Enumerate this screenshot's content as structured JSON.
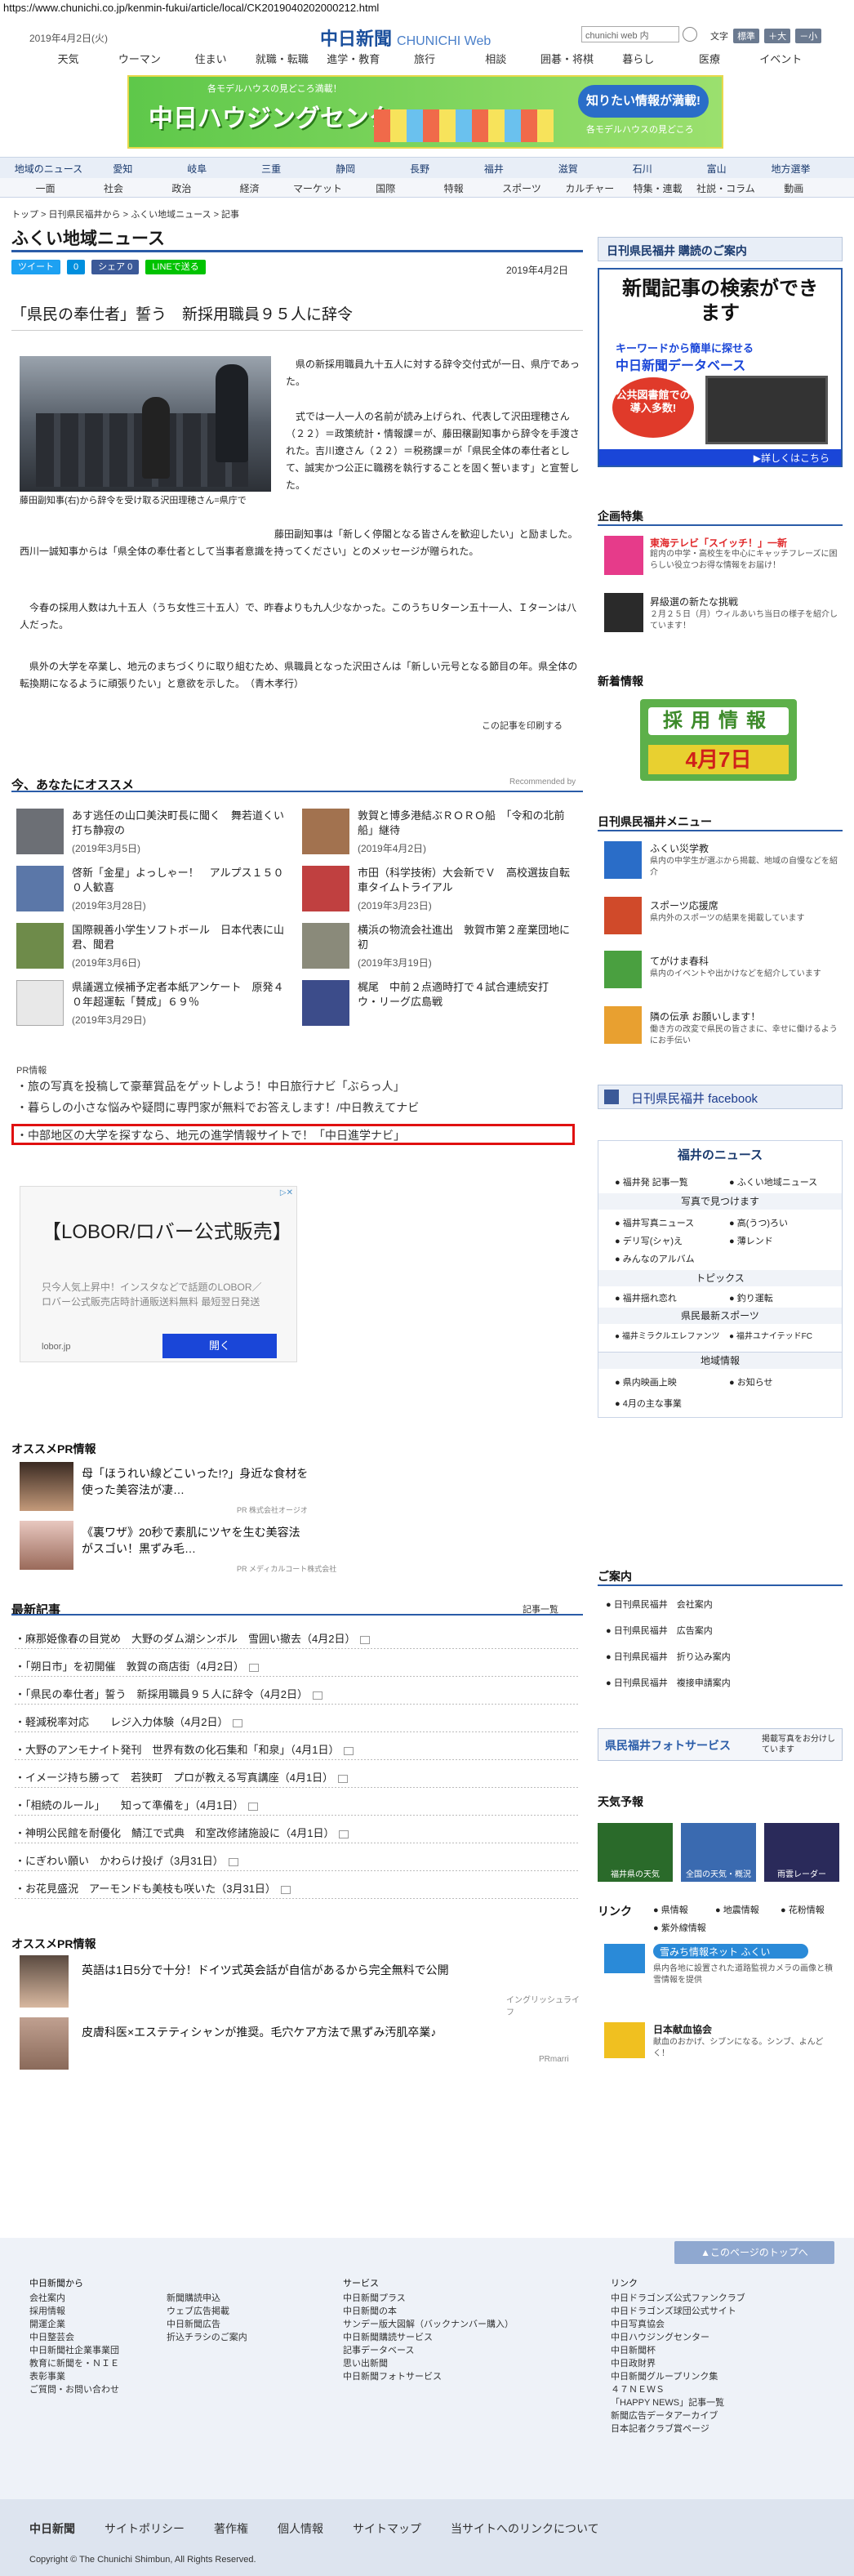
{
  "browser": {
    "url": "https://www.chunichi.co.jp/kenmin-fukui/article/local/CK2019040202000212.html"
  },
  "header": {
    "date": "2019年4月2日(火)",
    "logo": "中日新聞",
    "logo_sub": "CHUNICHI Web",
    "search_placeholder": "chunichi web 内",
    "font_label": "文字",
    "font_standard": "標準",
    "font_large": "＋大",
    "font_small": "－小",
    "nav": [
      "天気",
      "ウーマン",
      "住まい",
      "就職・転職",
      "進学・教育",
      "旅行",
      "相談",
      "囲碁・将棋",
      "暮らし",
      "医療",
      "イベント"
    ]
  },
  "banner": {
    "title": "中日ハウジングセンター",
    "tagline": "知りたい情報が満載!",
    "top_text": "各モデルハウスの見どころ満載！",
    "sub": "各モデルハウスの見どころ"
  },
  "nav2": [
    "地域のニュース",
    "愛知",
    "岐阜",
    "三重",
    "静岡",
    "長野",
    "福井",
    "滋賀",
    "石川",
    "富山",
    "地方選挙"
  ],
  "nav3": [
    "一面",
    "社会",
    "政治",
    "経済",
    "マーケット",
    "国際",
    "特報",
    "スポーツ",
    "カルチャー",
    "特集・連載",
    "社説・コラム",
    "動画"
  ],
  "breadcrumb": "トップ > 日刊県民福井から > ふくい地域ニュース > 記事",
  "page_title": "ふくい地域ニュース",
  "share": {
    "tweet": "ツイート",
    "hatena": "0",
    "fb": "シェア 0",
    "line": "LINEで送る"
  },
  "article": {
    "date": "2019年4月2日",
    "headline": "「県民の奉仕者」誓う　新採用職員９５人に辞令",
    "caption": "藤田副知事(右)から辞令を受け取る沢田理穂さん=県庁で",
    "p1": "県の新採用職員九十五人に対する辞令交付式が一日、県庁であった。",
    "p2": "式では一人一人の名前が読み上げられ、代表して沢田理穂さん（２２）＝政策統計・情報課＝が、藤田穣副知事から辞令を手渡された。吉川遼さん（２２）＝税務課＝が「県民全体の奉仕者として、誠実かつ公正に職務を執行することを固く誓います」と宣誓した。",
    "p3": "藤田副知事は「新しく停閣となる皆さんを歓迎したい」と励ました。西川一誠知事からは「県全体の奉仕者として当事者意識を持ってください」とのメッセージが贈られた。",
    "p4": "今春の採用人数は九十五人（うち女性三十五人）で、昨春よりも九人少なかった。このうちＵターン五十一人、Ｉターンは八人だった。",
    "p5": "県外の大学を卒業し、地元のまちづくりに取り組むため、県職員となった沢田さんは「新しい元号となる節目の年。県全体の転換期になるように頑張りたい」と意欲を示した。　（青木孝行）",
    "print": "この記事を印刷する"
  },
  "recommend": {
    "title": "今、あなたにオススメ",
    "by": "Recommended by",
    "items": [
      {
        "title": "あす逃任の山口美決町長に聞く　舞若道くい打ち静寂の",
        "date": "(2019年3月5日)"
      },
      {
        "title": "敦賀と博多港結ぶＲＯＲＯ船　「令和の北前船」継待",
        "date": "(2019年4月2日)"
      },
      {
        "title": "啓新「金星」よっしゃー！　アルプス１５００人歓喜",
        "date": "(2019年3月28日)"
      },
      {
        "title": "市田（科学技術）大会新でＶ　高校選抜自転車タイムトライアル",
        "date": "(2019年3月23日)"
      },
      {
        "title": "国際親善小学生ソフトボール　日本代表に山君、聞君",
        "date": "(2019年3月6日)"
      },
      {
        "title": "横浜の物流会社進出　敦賀市第２産業団地に初",
        "date": "(2019年3月19日)"
      },
      {
        "title": "県議選立候補予定者本紙アンケート　原発４０年超運転「賛成」６９％",
        "date": "(2019年3月29日)"
      },
      {
        "title": "梶尾　中前２点適時打で４試合連続安打　ウ・リーグ広島戦",
        "date": ""
      }
    ]
  },
  "pr": {
    "label": "PR情報",
    "links": [
      "旅の写真を投稿して豪華賞品をゲットしよう！中日旅行ナビ「ぶらっ人」",
      "暮らしの小さな悩みや疑問に専門家が無料でお答えします！/中日教えてナビ",
      "中部地区の大学を探すなら、地元の進学情報サイトで！「中日進学ナビ」"
    ]
  },
  "ad": {
    "headline": "【LOBOR/ロバー公式販売】",
    "body": "只今人気上昇中！インスタなどで話題のLOBOR／ロバー公式販売店時計通販送料無料 最短翌日発送",
    "site": "lobor.jp",
    "button": "開く"
  },
  "ospr": {
    "title": "オススメPR情報",
    "items": [
      {
        "title": "母「ほうれい線どこいった!?」身近な食材を使った美容法が凄…",
        "sponsor": "PR 株式会社オージオ"
      },
      {
        "title": "《裏ワザ》20秒で素肌にツヤを生む美容法がスゴい！黒ずみ毛…",
        "sponsor": "PR メディカルコート株式会社"
      }
    ]
  },
  "latest": {
    "title": "最新記事",
    "more": "記事一覧",
    "items": [
      "麻那姫像春の目覚め　大野のダム湖シンボル　雪囲い撤去（4月2日）",
      "「朔日市」を初開催　敦賀の商店街（4月2日）",
      "「県民の奉仕者」誓う　新採用職員９５人に辞令（4月2日）",
      "軽減税率対応　　レジ入力体験（4月2日）",
      "大野のアンモナイト発刊　世界有数の化石集和「和泉」（4月1日）",
      "イメージ持ち勝って　若狭町　プロが教える写真講座（4月1日）",
      "「相続のルール」　　知って準備を」（4月1日）",
      "神明公民館を耐優化　鯖江で式典　和室改修諸施設に（4月1日）",
      "にぎわい願い　かわらけ投げ（3月31日）",
      "お花見盛況　アーモンドも美枝も咲いた（3月31日）"
    ]
  },
  "pr2": {
    "title": "オススメPR情報",
    "items": [
      {
        "title": "英語は1日5分で十分！ドイツ式英会話が自信があるから完全無料で公開",
        "sponsor": "イングリッシュライフ"
      },
      {
        "title": "皮膚科医×エステティシャンが推奨。毛穴ケア方法で黒ずみ汚肌卒業♪",
        "sponsor": "PRmarri"
      }
    ]
  },
  "sidebar": {
    "subscribe": "日刊県民福井 購読のご案内",
    "db_title": "新聞記事の検索ができます",
    "db_sub": "キーワードから簡単に探せる",
    "db_name": "中日新聞データベース",
    "db_badge": "公共図書館での導入多数!",
    "db_more": "▶詳しくはこちら",
    "kikaku_title": "企画特集",
    "kikaku": [
      {
        "title": "東海テレビ「スイッチ！」一新",
        "desc": "館内の中学・高校生を中心にキャッチフレーズに困らしい役立つお得な情報をお届け！"
      },
      {
        "title": "昇級選の新たな挑戦",
        "desc": "２月２５日（月）ウィルあいち当日の様子を紹介しています！"
      }
    ],
    "new_title": "新着情報",
    "recruit": "採用情報",
    "recruit_date": "4月7日",
    "menu_title": "日刊県民福井メニュー",
    "menu": [
      {
        "title": "ふくい災学教",
        "desc": "県内の中学生が選ぶから揭載、地域の自慢などを紹介"
      },
      {
        "title": "スポーツ応援席",
        "desc": "県内外のスポーツの結果を掲載しています"
      },
      {
        "title": "てがけま春科",
        "desc": "県内のイベントや出かけなどを紹介しています"
      },
      {
        "title": "隣の伝承 お願いします！",
        "desc": "働き方の改変で県民の皆さまに、幸せに働けるようにお手伝い"
      }
    ],
    "facebook": "日刊県民福井 facebook",
    "fukui_news_title": "福井のニュース",
    "fukui_news": [
      "福井発 記事一覧",
      "ふくい地域ニュース"
    ],
    "photo_title": "写真で見つけます",
    "photos": [
      "福井写真ニュース",
      "高(うつ)ろい",
      "デリ写(シャ)え",
      "薄レンド",
      "みんなのアルバム"
    ],
    "topics_title": "トピックス",
    "topics": [
      "福井揺れ恋れ",
      "釣り運転"
    ],
    "sports_title": "県民最新スポーツ",
    "sports": [
      "福井ミラクルエレファンツ",
      "福井ユナイテッドFC"
    ],
    "area_title": "地域情報",
    "area": [
      "県内映画上映",
      "お知らせ",
      "4月の主な事業"
    ],
    "guide_title": "ご案内",
    "guide": [
      "日刊県民福井　会社案内",
      "日刊県民福井　広告案内",
      "日刊県民福井　折り込み案内",
      "日刊県民福井　複接申請案内"
    ],
    "photoservice": "県民福井フォトサービス",
    "photoservice_sub": "掲載写真をお分けしています",
    "weather_title": "天気予報",
    "weather": [
      "福井県の天気",
      "全国の天気・概況",
      "雨雲レーダー"
    ],
    "link_title": "リンク",
    "links": [
      "県情報",
      "地震情報",
      "花粉情報",
      "紫外線情報"
    ],
    "snow": "雪みち情報ネット ふくい",
    "snow_desc": "県内各地に設置された道路監視カメラの画像と積雪情報を提供",
    "blood": "日本献血協会",
    "blood_desc": "献血のおかげ、シブンになる。シンブ、よんどく！"
  },
  "footer": {
    "to_top": "▲このページのトップへ",
    "col1": {
      "h": "中日新聞から",
      "items": [
        "会社案内",
        "採用情報",
        "開運企業",
        "中日整芸会",
        "中日新聞社企業事業団",
        "教育に新聞を・ＮＩＥ",
        "表彰事業",
        "ご質問・お問い合わせ"
      ]
    },
    "col2": {
      "h": "",
      "items": [
        "新聞購読申込",
        "ウェブ広告掲載",
        "中日新聞広告",
        "折込チラシのご案内"
      ]
    },
    "col3": {
      "h": "サービス",
      "items": [
        "中日新聞プラス",
        "中日新聞の本",
        "サンデー版大図解（バックナンバー購入）",
        "中日新聞購読サービス",
        "記事データベース",
        "思い出新聞",
        "中日新聞フォトサービス"
      ]
    },
    "col4": {
      "h": "リンク",
      "items": [
        "中日ドラゴンズ公式ファンクラブ",
        "中日ドラゴンズ球団公式サイト",
        "中日写真協会",
        "中日ハウジングセンター",
        "中日新聞杯",
        "中日政財界",
        "中日新聞グループリンク集",
        "４７ＮＥＷＳ",
        "「HAPPY NEWS」記事一覧",
        "新聞広告データアーカイブ",
        "日本記者クラブ賞ページ"
      ]
    },
    "bar": [
      "中日新聞",
      "サイトポリシー",
      "著作権",
      "個人情報",
      "サイトマップ",
      "当サイトへのリンクについて"
    ],
    "copyright": "Copyright © The Chunichi Shimbun, All Rights Reserved."
  }
}
